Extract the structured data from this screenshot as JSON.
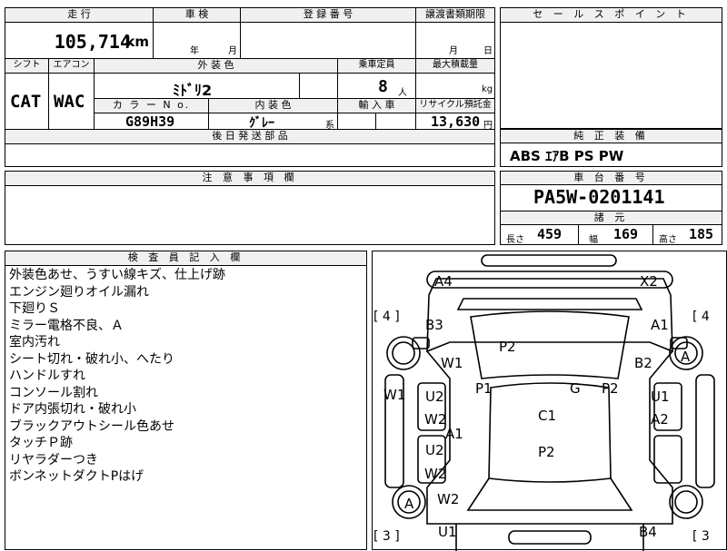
{
  "top": {
    "mileage_label": "走 行",
    "mileage_value": "105,714",
    "mileage_unit": "km",
    "inspection_label": "車 検",
    "inspection_year": "年",
    "inspection_month": "月",
    "registration_label": "登 録 番 号",
    "transfer_label": "譲渡書類期限",
    "transfer_month": "月",
    "transfer_day": "日",
    "shift_label": "シフト",
    "shift_value": "CAT",
    "ac_label": "エアコン",
    "ac_value": "WAC",
    "exterior_label": "外 装 色",
    "exterior_value": "ﾐﾄﾞﾘ2",
    "capacity_label": "乗車定員",
    "capacity_value": "8",
    "capacity_unit": "人",
    "load_label": "最大積載量",
    "load_unit": "kg",
    "color_no_label": "カ ラ ー N o.",
    "color_no_value": "G89H39",
    "interior_label": "内 装 色",
    "interior_value": "ｸﾞﾚｰ",
    "interior_suffix": "系",
    "import_label": "輸 入 車",
    "recycle_label": "リサイクル預託金",
    "recycle_value": "13,630",
    "recycle_unit": "円",
    "later_parts_label": "後 日 発 送 部 品"
  },
  "notes_label": "注 意 事 項 欄",
  "sales_point_label": "セ ー ル ス ポ イ ン ト",
  "equipment": {
    "label": "純 正 装 備",
    "value": "ABS ｴｱB PS PW"
  },
  "chassis": {
    "label": "車 台 番 号",
    "value": "PA5W-0201141",
    "spec_label": "諸 元",
    "length_label": "長さ",
    "length_value": "459",
    "width_label": "幅",
    "width_value": "169",
    "height_label": "高さ",
    "height_value": "185"
  },
  "inspector": {
    "label": "検 査 員 記 入 欄",
    "lines": [
      "外装色あせ、うすい線キズ、仕上げ跡",
      "エンジン廻りオイル漏れ",
      "下廻りＳ",
      "ミラー電格不良、Ａ",
      "室内汚れ",
      "シート切れ・破れ小、へたり",
      "ハンドルすれ",
      "コンソール割れ",
      "ドア内張切れ・破れ小",
      "ブラックアウトシール色あせ",
      "タッチＰ跡",
      "リヤラダーつき",
      "ボンネットダクトPはげ"
    ]
  },
  "diagram": {
    "labels": [
      {
        "id": "a4",
        "text": "A4"
      },
      {
        "id": "x2",
        "text": "X2"
      },
      {
        "id": "b3",
        "text": "B3"
      },
      {
        "id": "a1top",
        "text": "A1"
      },
      {
        "id": "p2top",
        "text": "P2"
      },
      {
        "id": "w1a",
        "text": "W1"
      },
      {
        "id": "b2",
        "text": "B2"
      },
      {
        "id": "tire_a_top",
        "text": "A"
      },
      {
        "id": "w1b",
        "text": "W1"
      },
      {
        "id": "u2a",
        "text": "U2"
      },
      {
        "id": "p1",
        "text": "P1"
      },
      {
        "id": "g",
        "text": "G"
      },
      {
        "id": "p2mid",
        "text": "P2"
      },
      {
        "id": "u1a",
        "text": "U1"
      },
      {
        "id": "w2a",
        "text": "W2"
      },
      {
        "id": "c1",
        "text": "C1"
      },
      {
        "id": "a2",
        "text": "A2"
      },
      {
        "id": "a1mid",
        "text": "A1"
      },
      {
        "id": "u2b",
        "text": "U2"
      },
      {
        "id": "p2low",
        "text": "P2"
      },
      {
        "id": "w2b",
        "text": "W2"
      },
      {
        "id": "tire_a_low",
        "text": "A"
      },
      {
        "id": "w2c",
        "text": "W2"
      },
      {
        "id": "u1b",
        "text": "U1"
      },
      {
        "id": "b4",
        "text": "B4"
      }
    ],
    "bracket_tl": "[ 4 ]",
    "bracket_tr": "[ 4",
    "bracket_bl": "[ 3 ]",
    "bracket_br": "[ 3"
  }
}
